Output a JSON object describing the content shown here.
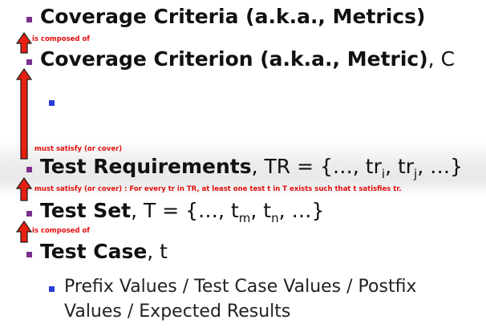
{
  "lines": {
    "criteria": {
      "bold": "Coverage Criteria (a.k.a., Metrics)",
      "rest": ""
    },
    "criterion": {
      "bold": "Coverage Criterion (a.k.a., Metric)",
      "rest": ", C"
    },
    "requirements": {
      "bold": "Test Requirements",
      "rest_a": ", TR = {…, tr",
      "sub_i": "i",
      "rest_b": ", tr",
      "sub_j": "j",
      "rest_c": ", …}"
    },
    "set": {
      "bold": "Test Set",
      "rest_a": ", T = {…, t",
      "sub_m": "m",
      "rest_b": ", t",
      "sub_n": "n",
      "rest_c": ", …}"
    },
    "case": {
      "bold": "Test Case",
      "rest": ", t"
    }
  },
  "arrow_labels": {
    "composed_1": "is composed of",
    "satisfy_1": "must satisfy (or cover)",
    "satisfy_2": "must satisfy (or cover) : For every tr in TR, at least one test t in T exists such that t satisfies tr.",
    "composed_2": "is composed of"
  },
  "case_details": {
    "line1": "Prefix Values / Test Case Values / Postfix",
    "line2": "Values / Expected Results"
  },
  "colors": {
    "bullet": "#7b2f8f",
    "sub_bullet": "#2a3bd6",
    "arrow_fill": "#e82010",
    "arrow_stroke": "#1a1a1a",
    "label": "#e30d0d"
  }
}
